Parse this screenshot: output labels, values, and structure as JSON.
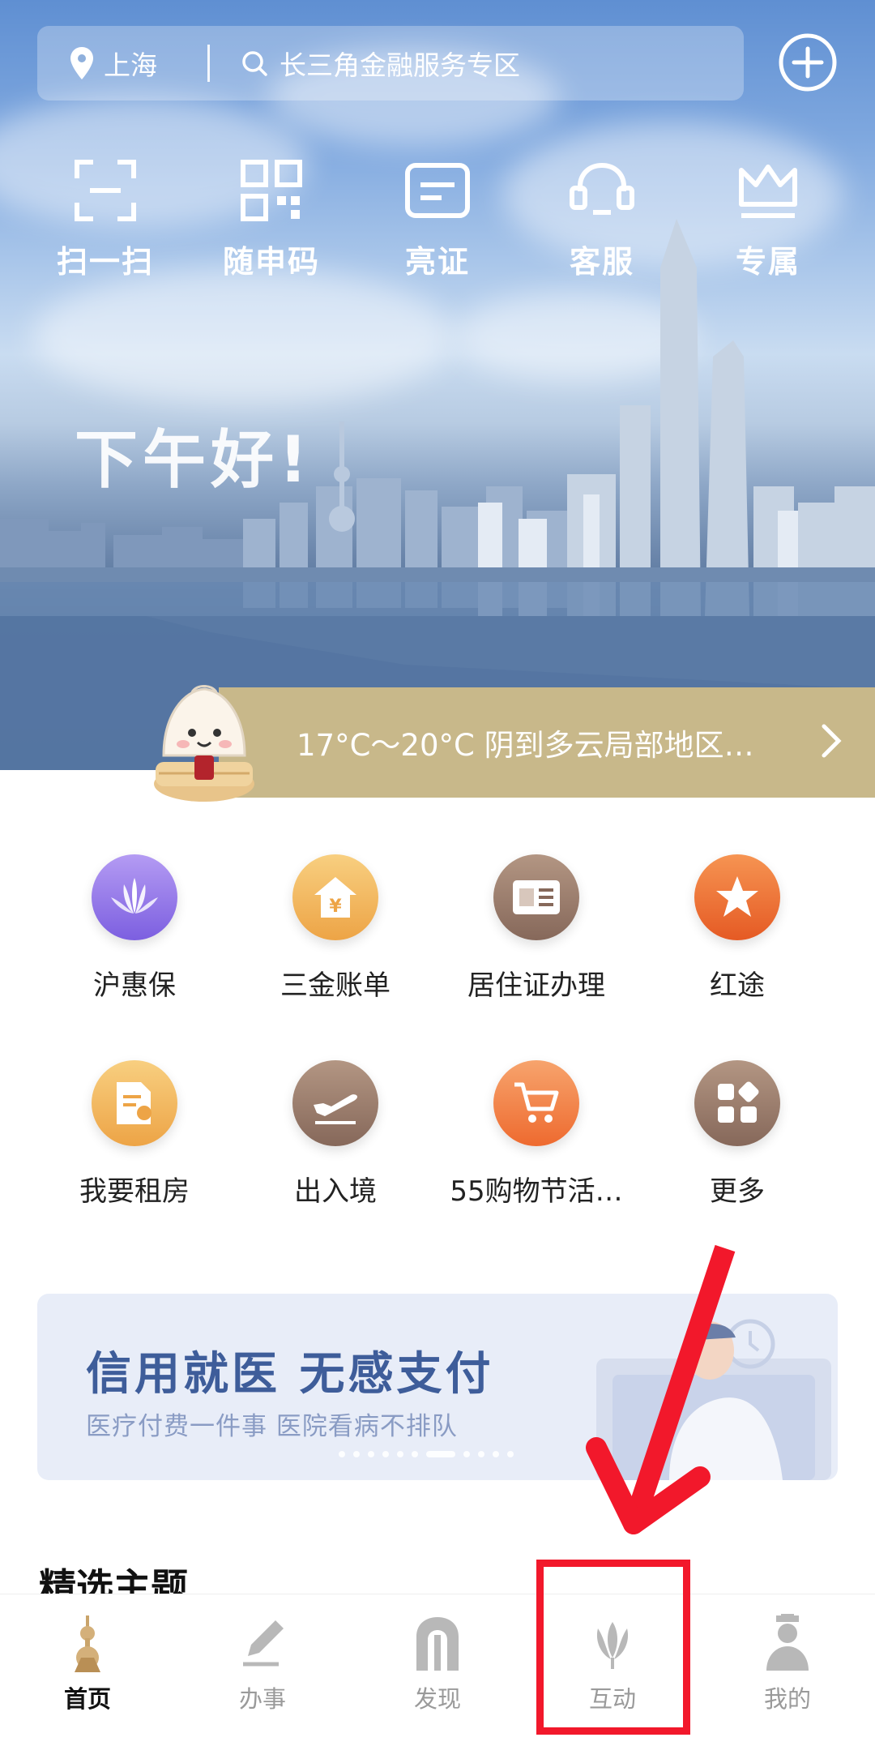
{
  "header": {
    "location": "上海",
    "search_placeholder": "长三角金融服务专区"
  },
  "quick_actions": [
    {
      "label": "扫一扫",
      "icon": "scan-icon"
    },
    {
      "label": "随申码",
      "icon": "qr-code-icon"
    },
    {
      "label": "亮证",
      "icon": "id-card-icon"
    },
    {
      "label": "客服",
      "icon": "customer-service-icon"
    },
    {
      "label": "专属",
      "icon": "crown-icon"
    }
  ],
  "greeting": "下午好!",
  "weather": {
    "text": "17°C～20°C 阴到多云局部地区…"
  },
  "services": [
    {
      "label": "沪惠保",
      "icon": "lotus-icon",
      "color": "#8e74e6"
    },
    {
      "label": "三金账单",
      "icon": "house-yen-icon",
      "color": "#f2b255"
    },
    {
      "label": "居住证办理",
      "icon": "residence-card-icon",
      "color": "#9a7b68"
    },
    {
      "label": "红途",
      "icon": "star-icon",
      "color": "#ee6a35"
    },
    {
      "label": "我要租房",
      "icon": "rental-doc-icon",
      "color": "#f2b255"
    },
    {
      "label": "出入境",
      "icon": "plane-icon",
      "color": "#9a7b68"
    },
    {
      "label": "55购物节活…",
      "icon": "cart-icon",
      "color": "#ef7d3c"
    },
    {
      "label": "更多",
      "icon": "grid-more-icon",
      "color": "#9a7b68"
    }
  ],
  "banner": {
    "title": "信用就医 无感支付",
    "subtitle": "医疗付费一件事 医院看病不排队"
  },
  "section_title": "精选主题",
  "bottom_nav": [
    {
      "label": "首页",
      "icon": "home-tower-icon",
      "active": true
    },
    {
      "label": "办事",
      "icon": "pen-icon",
      "active": false
    },
    {
      "label": "发现",
      "icon": "discover-gate-icon",
      "active": false
    },
    {
      "label": "互动",
      "icon": "magnolia-icon",
      "active": false
    },
    {
      "label": "我的",
      "icon": "person-icon",
      "active": false
    }
  ],
  "colors": {
    "accent_gold": "#c8b88a",
    "annotation_red": "#f2182b",
    "banner_blue": "#3e5d9a"
  }
}
